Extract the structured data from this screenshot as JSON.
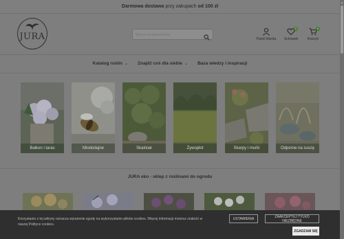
{
  "topbar": {
    "pre": "Darmowa dostawa",
    "mid": "przy zakupach",
    "post": "od 100 zł"
  },
  "logo": {
    "text": "JURA"
  },
  "search": {
    "placeholder": "Wpisz szukaną frazę"
  },
  "nav_icons": [
    {
      "label": "Panel klienta",
      "icon": "user-icon",
      "badge": ""
    },
    {
      "label": "Schowek",
      "icon": "heart-icon",
      "badge": "0"
    },
    {
      "label": "Koszyk",
      "icon": "cart-icon",
      "badge": "0"
    }
  ],
  "menu": [
    {
      "label": "Katalog roślin"
    },
    {
      "label": "Znajdź coś dla siebie"
    },
    {
      "label": "Baza wiedzy i inspiracji"
    }
  ],
  "categories": [
    {
      "label": "Balkon i taras"
    },
    {
      "label": "Miododajne"
    },
    {
      "label": "Skalniak"
    },
    {
      "label": "Żywopłot"
    },
    {
      "label": "Skarpy i murki"
    },
    {
      "label": "Odporne na suszę"
    }
  ],
  "section": {
    "title": "JURA eko - sklep z roślinami do ogrodu"
  },
  "cookie": {
    "text": "Korzystanie z tej witryny oznacza wyrażenie zgody na wykorzystanie plików cookies. Więcej informacji możesz znaleźć w naszej Polityce cookies.",
    "settings_label": "USTAWIENIA",
    "accept_necessary_label": "ZAAKCEPTUJ TYLKO NIEZBĘDNE",
    "agree_label": "ZGADZAM SIĘ"
  },
  "colors": {
    "badge": "#3f7a2a",
    "overlay": "#2f2f2f"
  }
}
